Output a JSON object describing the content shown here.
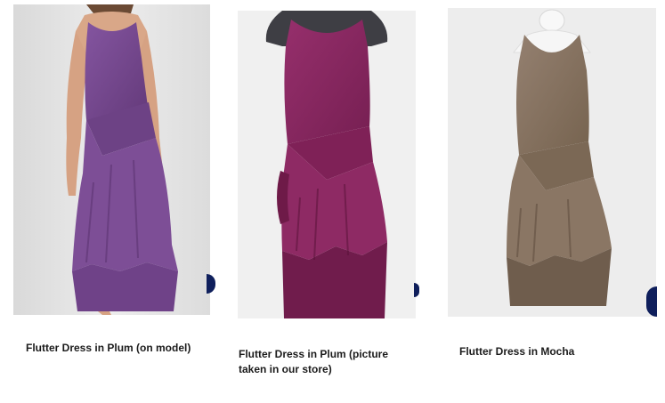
{
  "products": [
    {
      "caption": "Flutter Dress in Plum (on model)",
      "dress_color": "#7a4a8c",
      "dress_shade": "#5e3470",
      "background_color": "#e6e6e6"
    },
    {
      "caption": "Flutter Dress in Plum (picture taken in our store)",
      "dress_color": "#8a2a62",
      "dress_shade": "#6a1a48",
      "background_color": "#eeeeee"
    },
    {
      "caption": "Flutter Dress in Mocha",
      "dress_color": "#8a7564",
      "dress_shade": "#6e5c4c",
      "background_color": "#ececec"
    }
  ]
}
